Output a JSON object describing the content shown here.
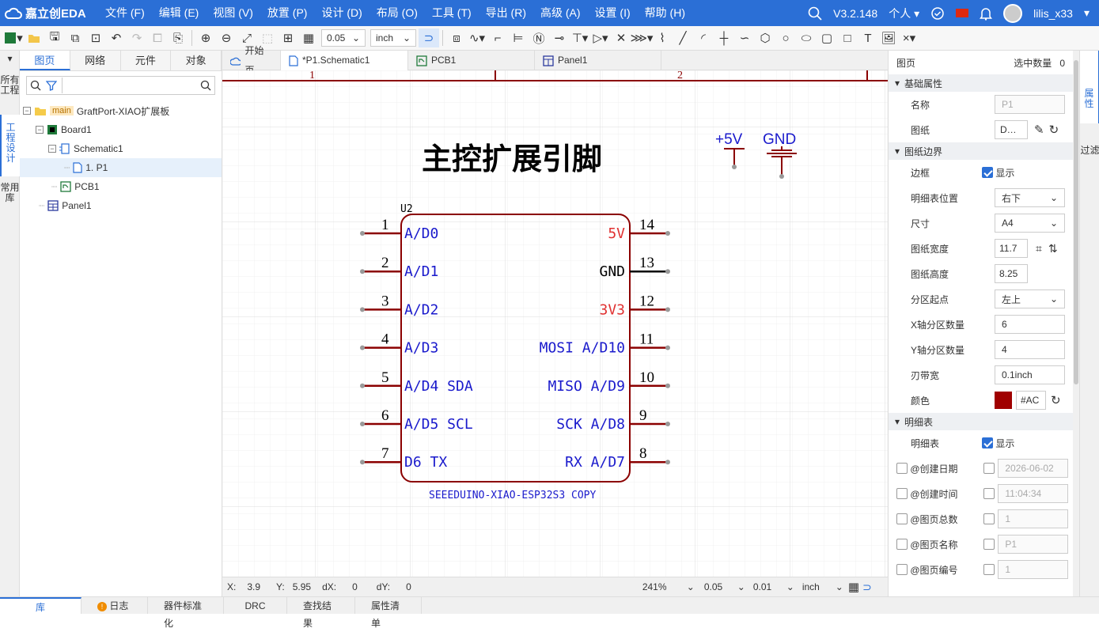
{
  "app": {
    "name": "嘉立创EDA",
    "version": "V3.2.148",
    "personal": "个人",
    "user": "lilis_x33"
  },
  "menus": [
    "文件 (F)",
    "编辑 (E)",
    "视图 (V)",
    "放置 (P)",
    "设计 (D)",
    "布局 (O)",
    "工具 (T)",
    "导出 (R)",
    "高级 (A)",
    "设置 (I)",
    "帮助 (H)"
  ],
  "toolbar": {
    "grid": "0.05",
    "unit": "inch"
  },
  "left_vtabs": [
    "所有工程",
    "工程设计",
    "常用库"
  ],
  "left_panel": {
    "tabs": [
      "图页",
      "网络",
      "元件",
      "对象"
    ],
    "tree": [
      {
        "label": "GraftPort-XIAO扩展板",
        "tag": "main",
        "level": 0,
        "icon": "folder-icon"
      },
      {
        "label": "Board1",
        "level": 1,
        "icon": "board-icon"
      },
      {
        "label": "Schematic1",
        "level": 2,
        "icon": "schematic-icon"
      },
      {
        "label": "1. P1",
        "level": 3,
        "icon": "page-icon",
        "selected": true
      },
      {
        "label": "PCB1",
        "level": 2,
        "icon": "pcb-icon"
      },
      {
        "label": "Panel1",
        "level": 1,
        "icon": "panel-icon"
      }
    ]
  },
  "doc_tabs": [
    {
      "label": "开始页",
      "icon": "cloud-icon"
    },
    {
      "label": "*P1.Schematic1",
      "icon": "page-icon",
      "active": true
    },
    {
      "label": "PCB1",
      "icon": "pcb-icon"
    },
    {
      "label": "Panel1",
      "icon": "panel-icon"
    }
  ],
  "schematic": {
    "title": "主控扩展引脚",
    "zone_labels": [
      "1",
      "2"
    ],
    "power_5v": "+5V",
    "power_gnd": "GND",
    "designator": "U2",
    "part_name": "SEEEDUINO-XIAO-ESP32S3 COPY",
    "left_pins": [
      {
        "num": "1",
        "name": "A/D0"
      },
      {
        "num": "2",
        "name": "A/D1"
      },
      {
        "num": "3",
        "name": "A/D2"
      },
      {
        "num": "4",
        "name": "A/D3"
      },
      {
        "num": "5",
        "name": "A/D4 SDA"
      },
      {
        "num": "6",
        "name": "A/D5 SCL"
      },
      {
        "num": "7",
        "name": "D6 TX"
      }
    ],
    "right_pins": [
      {
        "num": "14",
        "name": "5V",
        "color": "#e03030"
      },
      {
        "num": "13",
        "name": "GND",
        "color": "#000000"
      },
      {
        "num": "12",
        "name": "3V3",
        "color": "#e03030"
      },
      {
        "num": "11",
        "name": "MOSI A/D10",
        "color": "#1a1acc"
      },
      {
        "num": "10",
        "name": "MISO A/D9",
        "color": "#1a1acc"
      },
      {
        "num": "9",
        "name": "SCK A/D8",
        "color": "#1a1acc"
      },
      {
        "num": "8",
        "name": "RX A/D7",
        "color": "#1a1acc"
      }
    ]
  },
  "status": {
    "x_label": "X:",
    "x": "3.9",
    "y_label": "Y:",
    "y": "5.95",
    "dx_label": "dX:",
    "dx": "0",
    "dy_label": "dY:",
    "dy": "0",
    "zoom": "241%",
    "grid": "0.05",
    "snap": "0.01",
    "unit": "inch"
  },
  "bottom_tabs": [
    "库",
    "日志",
    "器件标准化",
    "DRC",
    "查找结果",
    "属性清单"
  ],
  "right_panel": {
    "header": "图页",
    "selected_count_label": "选中数量",
    "selected_count": "0",
    "sections": {
      "basic": "基础属性",
      "border": "图纸边界",
      "detail": "明细表"
    },
    "name_label": "名称",
    "name_value": "P1",
    "sheet_label": "图纸",
    "sheet_value": "D…",
    "frame_label": "边框",
    "frame_show": "显示",
    "table_pos_label": "明细表位置",
    "table_pos": "右下",
    "size_label": "尺寸",
    "size": "A4",
    "width_label": "图纸宽度",
    "width": "11.7",
    "height_label": "图纸高度",
    "height": "8.25",
    "zone_origin_label": "分区起点",
    "zone_origin": "左上",
    "x_zones_label": "X轴分区数量",
    "x_zones": "6",
    "y_zones_label": "Y轴分区数量",
    "y_zones": "4",
    "strip_label": "刃带宽",
    "strip": "0.1inch",
    "color_label": "颜色",
    "color_hex": "#AC",
    "color_swatch": "#a00000",
    "detail_label": "明细表",
    "detail_show": "显示",
    "fields": [
      {
        "label": "@创建日期",
        "value": "2026-06-02"
      },
      {
        "label": "@创建时间",
        "value": "11:04:34"
      },
      {
        "label": "@图页总数",
        "value": "1"
      },
      {
        "label": "@图页名称",
        "value": "P1"
      },
      {
        "label": "@图页编号",
        "value": "1"
      }
    ]
  },
  "right_vtabs": [
    "属性",
    "过滤"
  ]
}
